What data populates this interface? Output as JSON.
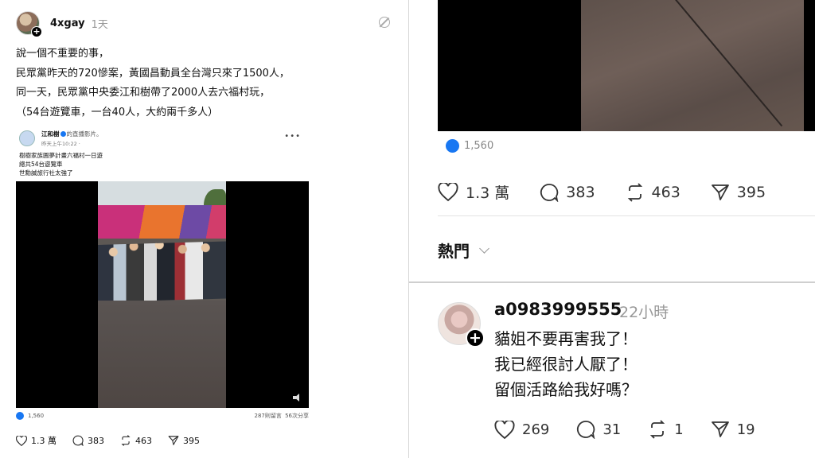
{
  "left_post": {
    "username": "4xgay",
    "time": "1天",
    "lines": [
      "說一個不重要的事，",
      "民眾黨昨天的720慘案，黃國昌動員全台灣只來了1500人，",
      "同一天，民眾黨中央委江和樹帶了2000人去六福村玩，",
      "（54台遊覽車，一台40人，大約兩千多人）"
    ],
    "embed": {
      "author": "江和樹",
      "author_suffix": "的直播影片。",
      "date": "昨天上午10:22 · ",
      "lines": [
        "樹樹家族圓夢計畫六福村一日遊",
        "總共54台遊覽車",
        "世勳誠旅行社太強了"
      ],
      "likes": "1,560",
      "comments_shares": "287則留言 56次分享"
    },
    "actions": {
      "likes": "1.3 萬",
      "comments": "383",
      "reposts": "463",
      "shares": "395"
    }
  },
  "right_top": {
    "likes": "1,560",
    "actions": {
      "likes": "1.3 萬",
      "comments": "383",
      "reposts": "463",
      "shares": "395"
    },
    "sort_label": "熱門"
  },
  "comment": {
    "username": "a0983999555",
    "time": "22小時",
    "lines": [
      "貓姐不要再害我了！",
      "我已經很討人厭了！",
      "留個活路給我好嗎？"
    ],
    "actions": {
      "likes": "269",
      "comments": "31",
      "reposts": "1",
      "shares": "19"
    }
  }
}
